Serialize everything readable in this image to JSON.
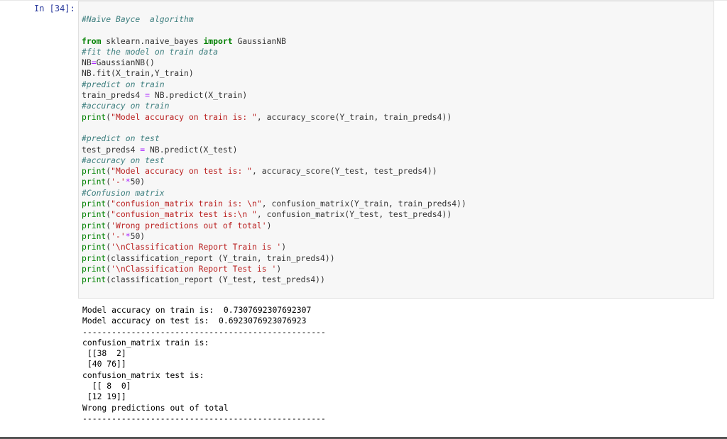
{
  "cell": {
    "prompt": "In [34]:"
  },
  "code_lines": [
    "#Naïve Bayce  algorithm",
    "",
    "from sklearn.naive_bayes import GaussianNB",
    "#fit the model on train data",
    "NB=GaussianNB()",
    "NB.fit(X_train,Y_train)",
    "#predict on train",
    "train_preds4 = NB.predict(X_train)",
    "#accuracy on train",
    "print(\"Model accuracy on train is: \", accuracy_score(Y_train, train_preds4))",
    "",
    "#predict on test",
    "test_preds4 = NB.predict(X_test)",
    "#accuracy on test",
    "print(\"Model accuracy on test is: \", accuracy_score(Y_test, test_preds4))",
    "print('-'*50)",
    "#Confusion matrix",
    "print(\"confusion_matrix train is: \\n\", confusion_matrix(Y_train, train_preds4))",
    "print(\"confusion_matrix test is:\\n \", confusion_matrix(Y_test, test_preds4))",
    "print('Wrong predictions out of total')",
    "print('-'*50)",
    "print('\\nClassification Report Train is ')",
    "print(classification_report (Y_train, train_preds4))",
    "print('\\nClassification Report Test is ')",
    "print(classification_report (Y_test, test_preds4))"
  ],
  "output_lines": [
    "Model accuracy on train is:  0.7307692307692307",
    "Model accuracy on test is:  0.6923076923076923",
    "--------------------------------------------------",
    "confusion_matrix train is: ",
    " [[38  2]",
    " [40 76]]",
    "confusion_matrix test is:",
    "  [[ 8  0]",
    " [12 19]]",
    "Wrong predictions out of total",
    "--------------------------------------------------"
  ],
  "colors": {
    "prompt": "#303f9f",
    "comment": "#408080",
    "keyword": "#008000",
    "string": "#ba2121",
    "operator": "#aa22ff",
    "cell_background": "#f7f7f7"
  }
}
